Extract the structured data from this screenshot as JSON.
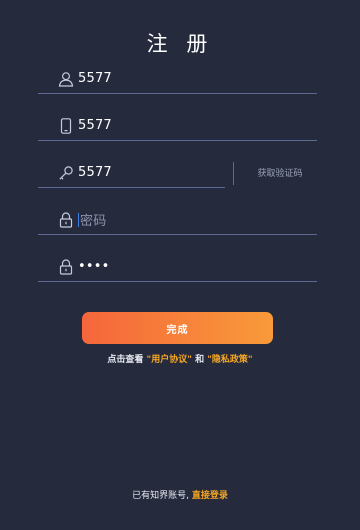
{
  "title": "注 册",
  "fields": {
    "username": {
      "value": "5577",
      "icon": "user-icon"
    },
    "phone": {
      "value": "5577",
      "icon": "phone-icon"
    },
    "code": {
      "value": "5577",
      "icon": "key-icon"
    },
    "password": {
      "placeholder": "密码",
      "icon": "lock-icon"
    },
    "confirm": {
      "value": "••••",
      "icon": "lock-icon"
    }
  },
  "get_code_label": "获取验证码",
  "submit_label": "完成",
  "terms": {
    "prefix": "点击查看",
    "user_agreement": "\"用户协议\"",
    "and": "和",
    "privacy": "\"隐私政策\""
  },
  "login": {
    "prefix": "已有知界账号,",
    "link": "直接登录"
  },
  "colors": {
    "background": "#252a3d",
    "accent": "#f5a623",
    "button_gradient_start": "#f5663b",
    "button_gradient_end": "#f99a3a"
  }
}
